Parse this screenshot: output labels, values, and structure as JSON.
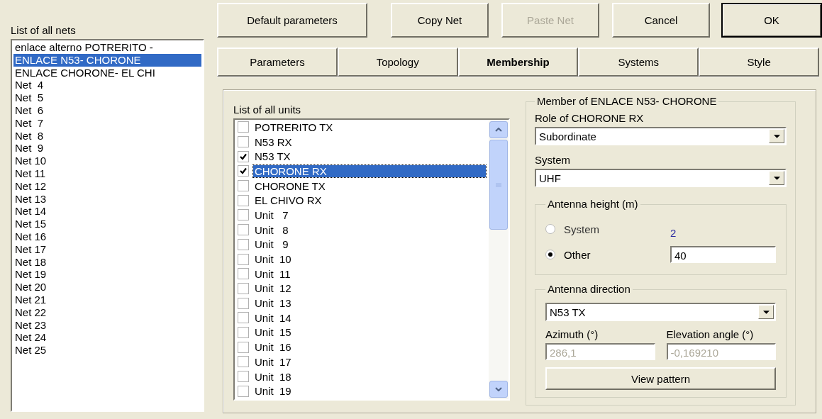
{
  "nets_list": {
    "label": "List of all nets",
    "items": [
      {
        "name": "enlace alterno POTRERITO -",
        "selected": false
      },
      {
        "name": "ENLACE N53- CHORONE",
        "selected": true
      },
      {
        "name": "ENLACE CHORONE- EL CHI",
        "selected": false
      },
      {
        "name": "Net  4",
        "selected": false
      },
      {
        "name": "Net  5",
        "selected": false
      },
      {
        "name": "Net  6",
        "selected": false
      },
      {
        "name": "Net  7",
        "selected": false
      },
      {
        "name": "Net  8",
        "selected": false
      },
      {
        "name": "Net  9",
        "selected": false
      },
      {
        "name": "Net 10",
        "selected": false
      },
      {
        "name": "Net 11",
        "selected": false
      },
      {
        "name": "Net 12",
        "selected": false
      },
      {
        "name": "Net 13",
        "selected": false
      },
      {
        "name": "Net 14",
        "selected": false
      },
      {
        "name": "Net 15",
        "selected": false
      },
      {
        "name": "Net 16",
        "selected": false
      },
      {
        "name": "Net 17",
        "selected": false
      },
      {
        "name": "Net 18",
        "selected": false
      },
      {
        "name": "Net 19",
        "selected": false
      },
      {
        "name": "Net 20",
        "selected": false
      },
      {
        "name": "Net 21",
        "selected": false
      },
      {
        "name": "Net 22",
        "selected": false
      },
      {
        "name": "Net 23",
        "selected": false
      },
      {
        "name": "Net 24",
        "selected": false
      },
      {
        "name": "Net 25",
        "selected": false
      }
    ]
  },
  "buttons": [
    {
      "label": "Default parameters",
      "disabled": false,
      "default": false
    },
    {
      "label": "Copy Net",
      "disabled": false,
      "default": false
    },
    {
      "label": "Paste Net",
      "disabled": true,
      "default": false
    },
    {
      "label": "Cancel",
      "disabled": false,
      "default": false
    },
    {
      "label": "OK",
      "disabled": false,
      "default": true
    }
  ],
  "tabs": [
    {
      "label": "Parameters",
      "selected": false
    },
    {
      "label": "Topology",
      "selected": false
    },
    {
      "label": "Membership",
      "selected": true
    },
    {
      "label": "Systems",
      "selected": false
    },
    {
      "label": "Style",
      "selected": false
    }
  ],
  "units_list": {
    "label": "List of all units",
    "items": [
      {
        "name": "POTRERITO TX",
        "checked": false,
        "selected": false
      },
      {
        "name": "N53 RX",
        "checked": false,
        "selected": false
      },
      {
        "name": "N53 TX",
        "checked": true,
        "selected": false
      },
      {
        "name": "CHORONE RX",
        "checked": true,
        "selected": true
      },
      {
        "name": "CHORONE TX",
        "checked": false,
        "selected": false
      },
      {
        "name": "EL CHIVO RX",
        "checked": false,
        "selected": false
      },
      {
        "name": "Unit   7",
        "checked": false,
        "selected": false
      },
      {
        "name": "Unit   8",
        "checked": false,
        "selected": false
      },
      {
        "name": "Unit   9",
        "checked": false,
        "selected": false
      },
      {
        "name": "Unit  10",
        "checked": false,
        "selected": false
      },
      {
        "name": "Unit  11",
        "checked": false,
        "selected": false
      },
      {
        "name": "Unit  12",
        "checked": false,
        "selected": false
      },
      {
        "name": "Unit  13",
        "checked": false,
        "selected": false
      },
      {
        "name": "Unit  14",
        "checked": false,
        "selected": false
      },
      {
        "name": "Unit  15",
        "checked": false,
        "selected": false
      },
      {
        "name": "Unit  16",
        "checked": false,
        "selected": false
      },
      {
        "name": "Unit  17",
        "checked": false,
        "selected": false
      },
      {
        "name": "Unit  18",
        "checked": false,
        "selected": false
      },
      {
        "name": "Unit  19",
        "checked": false,
        "selected": false
      }
    ]
  },
  "membership": {
    "title": "Member of ENLACE N53- CHORONE",
    "role_label": "Role of CHORONE RX",
    "role_value": "Subordinate",
    "system_label": "System",
    "system_value": "UHF",
    "antenna_height": {
      "title": "Antenna height (m)",
      "options": [
        {
          "kind": "reading",
          "label": "System",
          "selected": false,
          "value": "2"
        },
        {
          "kind": "field",
          "label": "Other",
          "selected": true,
          "value": "40"
        }
      ]
    },
    "antenna_direction": {
      "title": "Antenna direction",
      "target": "N53 TX",
      "azimuth_label": "Azimuth (°)",
      "azimuth_value": "286,1",
      "elevation_label": "Elevation angle (°)",
      "elevation_value": "-0,169210",
      "button": "View pattern"
    }
  }
}
